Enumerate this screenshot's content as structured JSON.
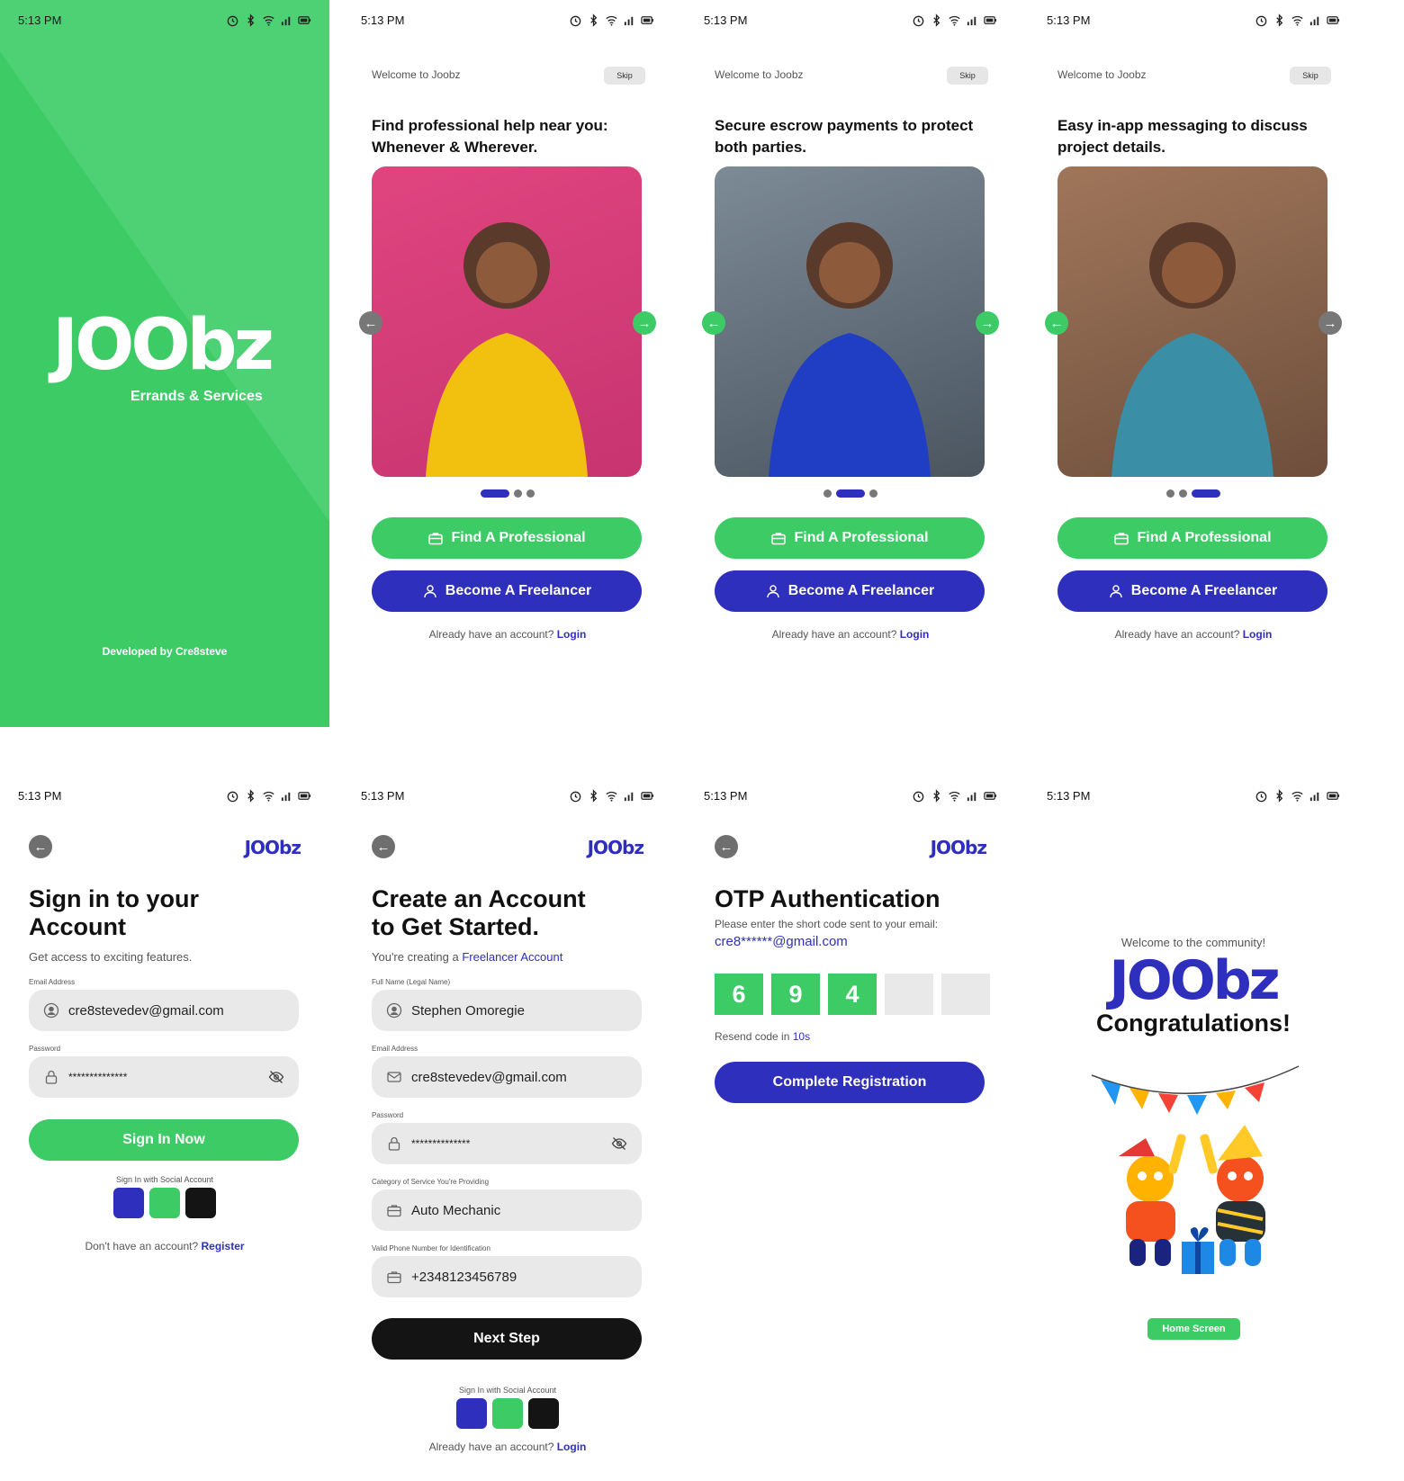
{
  "status": {
    "time": "5:13 PM"
  },
  "splash": {
    "logo": "JOObz",
    "tagline": "Errands & Services",
    "credit": "Developed by Cre8steve"
  },
  "onboarding": {
    "welcome": "Welcome to Joobz",
    "skip": "Skip",
    "find_label": "Find A Professional",
    "become_label": "Become A Freelancer",
    "already": "Already have an account?",
    "login": "Login",
    "slides": [
      {
        "title": "Find professional help near you: Whenever & Wherever.",
        "active_dot": 0
      },
      {
        "title": "Secure escrow payments to protect both parties.",
        "active_dot": 1
      },
      {
        "title": "Easy in-app messaging to discuss project details.",
        "active_dot": 2
      }
    ]
  },
  "signin": {
    "logo": "JOObz",
    "title": "Sign in to your Account",
    "subtitle": "Get access to exciting features.",
    "email_label": "Email Address",
    "email_value": "cre8stevedev@gmail.com",
    "password_label": "Password",
    "password_value": "**************",
    "submit": "Sign In Now",
    "social_label": "Sign In with Social Account",
    "no_account": "Don't have an account?",
    "register": "Register"
  },
  "create": {
    "logo": "JOObz",
    "title": "Create an Account to Get Started.",
    "subtitle_prefix": "You're creating a",
    "subtitle_link": "Freelancer Account",
    "fullname_label": "Full Name (Legal Name)",
    "fullname_value": "Stephen Omoregie",
    "email_label": "Email Address",
    "email_value": "cre8stevedev@gmail.com",
    "password_label": "Password",
    "password_value": "**************",
    "category_label": "Category of Service You're Providing",
    "category_value": "Auto Mechanic",
    "phone_label": "Valid Phone Number for Identification",
    "phone_value": "+2348123456789",
    "next": "Next Step",
    "social_label": "Sign In with Social Account",
    "already": "Already have an account?",
    "login": "Login"
  },
  "otp": {
    "logo": "JOObz",
    "title": "OTP Authentication",
    "instructions": "Please enter the short code sent to your email:",
    "email": "cre8******@gmail.com",
    "digits": [
      "6",
      "9",
      "4",
      "",
      ""
    ],
    "resend_prefix": "Resend code in",
    "resend_time": "10s",
    "submit": "Complete Registration"
  },
  "congrats": {
    "welcome": "Welcome to the  community!",
    "logo": "JOObz",
    "title": "Congratulations!",
    "home_button": "Home Screen"
  },
  "colors": {
    "green": "#3dcb66",
    "blue": "#2f2fbe",
    "black": "#141414"
  }
}
